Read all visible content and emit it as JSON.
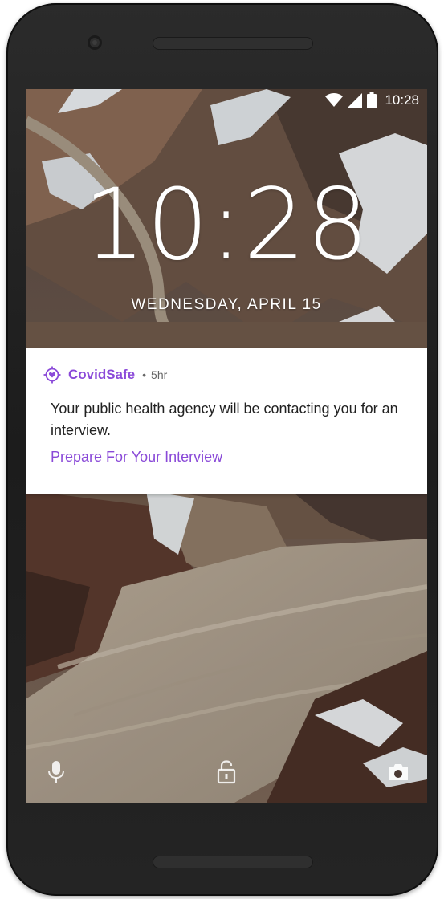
{
  "status_bar": {
    "time": "10:28",
    "icons": [
      "wifi-icon",
      "cell-signal-icon",
      "battery-icon"
    ]
  },
  "lockscreen": {
    "clock": "10:28",
    "date": "WEDNESDAY, APRIL 15"
  },
  "notification": {
    "app_icon": "covidsafe-heart-target-icon",
    "app_name": "CovidSafe",
    "separator": "•",
    "time": "5hr",
    "body": "Your public health agency will be contacting you for an interview.",
    "action": "Prepare For Your Interview"
  },
  "bottom_shortcuts": {
    "icons": [
      "microphone-icon",
      "lock-icon",
      "camera-icon"
    ]
  },
  "colors": {
    "accent": "#8b4ad9",
    "notification_bg": "#ffffff",
    "body_text": "#212121"
  }
}
